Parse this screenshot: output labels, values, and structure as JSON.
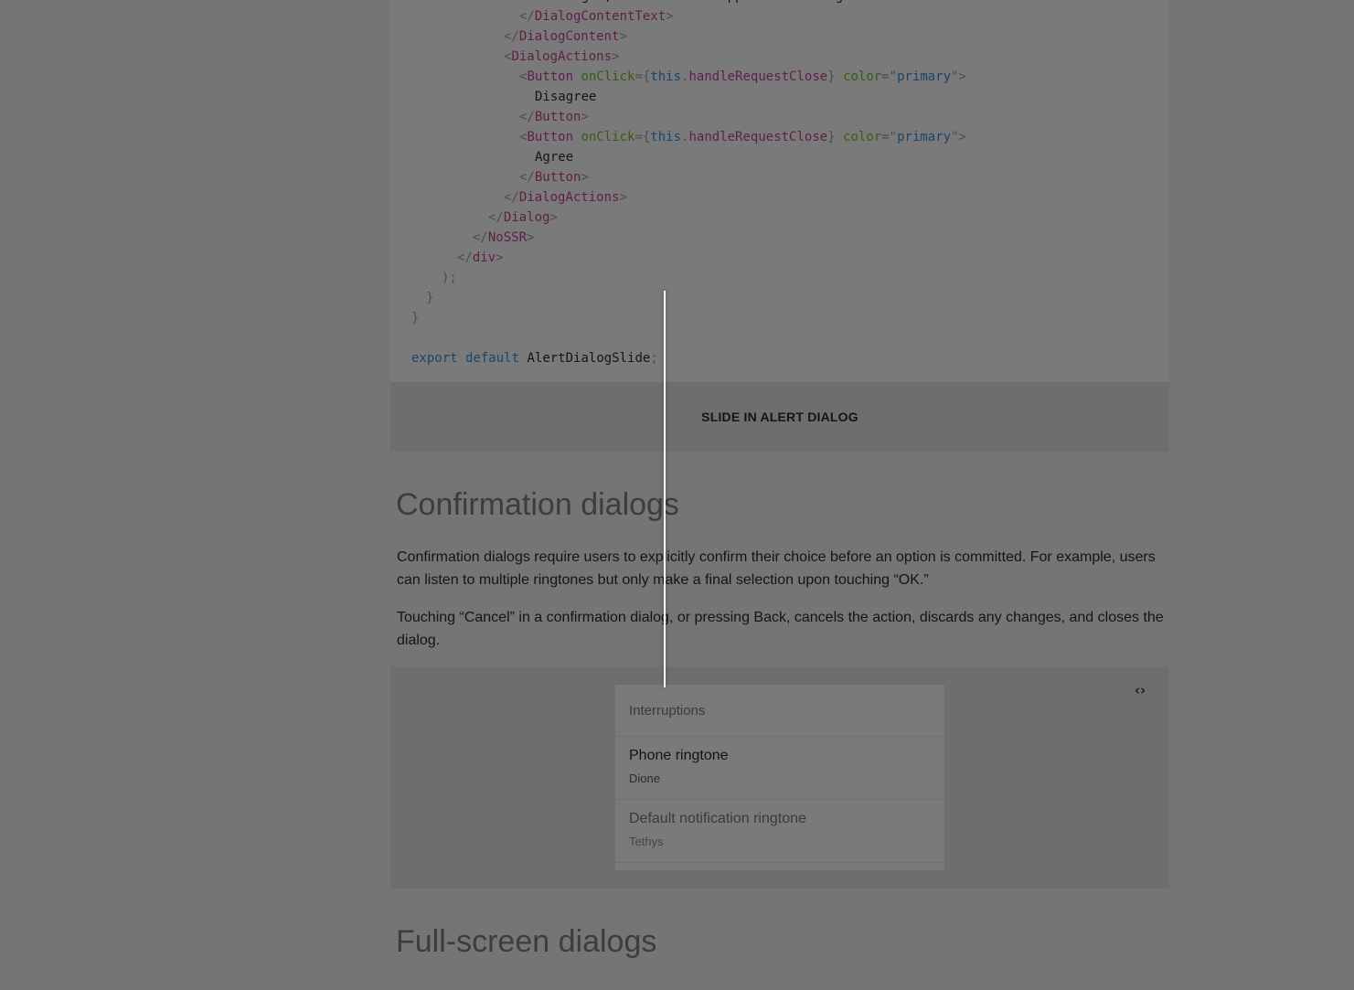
{
  "code": {
    "lines": [
      [
        {
          "t": "to Google, even when no apps are running.",
          "c": "plain"
        }
      ],
      [
        {
          "t": "</",
          "c": "punc"
        },
        {
          "t": "DialogContentText",
          "c": "tag"
        },
        {
          "t": ">",
          "c": "punc"
        }
      ],
      [
        {
          "t": "</",
          "c": "punc"
        },
        {
          "t": "DialogContent",
          "c": "tag"
        },
        {
          "t": ">",
          "c": "punc"
        }
      ],
      [
        {
          "t": "<",
          "c": "punc"
        },
        {
          "t": "DialogActions",
          "c": "tag"
        },
        {
          "t": ">",
          "c": "punc"
        }
      ],
      [
        {
          "t": "<",
          "c": "punc"
        },
        {
          "t": "Button",
          "c": "tag"
        },
        {
          "t": " ",
          "c": "plain"
        },
        {
          "t": "onClick",
          "c": "attr"
        },
        {
          "t": "={",
          "c": "punc"
        },
        {
          "t": "this",
          "c": "kw"
        },
        {
          "t": ".",
          "c": "punc"
        },
        {
          "t": "handleRequestClose",
          "c": "fn"
        },
        {
          "t": "}",
          "c": "punc"
        },
        {
          "t": " ",
          "c": "plain"
        },
        {
          "t": "color",
          "c": "attr"
        },
        {
          "t": "=\"",
          "c": "punc"
        },
        {
          "t": "primary",
          "c": "strv"
        },
        {
          "t": "\">",
          "c": "punc"
        }
      ],
      [
        {
          "t": "Disagree",
          "c": "plain"
        }
      ],
      [
        {
          "t": "</",
          "c": "punc"
        },
        {
          "t": "Button",
          "c": "tag"
        },
        {
          "t": ">",
          "c": "punc"
        }
      ],
      [
        {
          "t": "<",
          "c": "punc"
        },
        {
          "t": "Button",
          "c": "tag"
        },
        {
          "t": " ",
          "c": "plain"
        },
        {
          "t": "onClick",
          "c": "attr"
        },
        {
          "t": "={",
          "c": "punc"
        },
        {
          "t": "this",
          "c": "kw"
        },
        {
          "t": ".",
          "c": "punc"
        },
        {
          "t": "handleRequestClose",
          "c": "fn"
        },
        {
          "t": "}",
          "c": "punc"
        },
        {
          "t": " ",
          "c": "plain"
        },
        {
          "t": "color",
          "c": "attr"
        },
        {
          "t": "=\"",
          "c": "punc"
        },
        {
          "t": "primary",
          "c": "strv"
        },
        {
          "t": "\">",
          "c": "punc"
        }
      ],
      [
        {
          "t": "Agree",
          "c": "plain"
        }
      ],
      [
        {
          "t": "</",
          "c": "punc"
        },
        {
          "t": "Button",
          "c": "tag"
        },
        {
          "t": ">",
          "c": "punc"
        }
      ],
      [
        {
          "t": "</",
          "c": "punc"
        },
        {
          "t": "DialogActions",
          "c": "tag"
        },
        {
          "t": ">",
          "c": "punc"
        }
      ],
      [
        {
          "t": "</",
          "c": "punc"
        },
        {
          "t": "Dialog",
          "c": "tag"
        },
        {
          "t": ">",
          "c": "punc"
        }
      ],
      [
        {
          "t": "</",
          "c": "punc"
        },
        {
          "t": "NoSSR",
          "c": "tag"
        },
        {
          "t": ">",
          "c": "punc"
        }
      ],
      [
        {
          "t": "</",
          "c": "punc"
        },
        {
          "t": "div",
          "c": "tag"
        },
        {
          "t": ">",
          "c": "punc"
        }
      ],
      [
        {
          "t": ");",
          "c": "punc"
        }
      ],
      [
        {
          "t": "}",
          "c": "punc"
        }
      ],
      [
        {
          "t": "}",
          "c": "punc"
        }
      ],
      [
        {
          "t": "export",
          "c": "kw"
        },
        {
          "t": " ",
          "c": "plain"
        },
        {
          "t": "default",
          "c": "kw"
        },
        {
          "t": " AlertDialogSlide",
          "c": "plain"
        },
        {
          "t": ";",
          "c": "punc"
        }
      ]
    ]
  },
  "demo_button_label": "Slide in alert dialog",
  "confirmation": {
    "heading": "Confirmation dialogs",
    "paragraph_1": "Confirmation dialogs require users to explicitly confirm their choice before an option is committed. For example, users can listen to multiple ringtones but only make a final selection upon touching “OK.”",
    "paragraph_2": "Touching “Cancel” in a confirmation dialog, or pressing Back, cancels the action, discards any changes, and closes the dialog."
  },
  "demo": {
    "code_toggle_icon": "code-icon",
    "code_toggle_glyph": "‹›",
    "list_subheader": "Interruptions",
    "items": [
      {
        "primary": "Phone ringtone",
        "secondary": "Dione",
        "disabled": false
      },
      {
        "primary": "Default notification ringtone",
        "secondary": "Tethys",
        "disabled": true
      }
    ]
  },
  "fullscreen": {
    "heading": "Full-screen dialogs"
  }
}
